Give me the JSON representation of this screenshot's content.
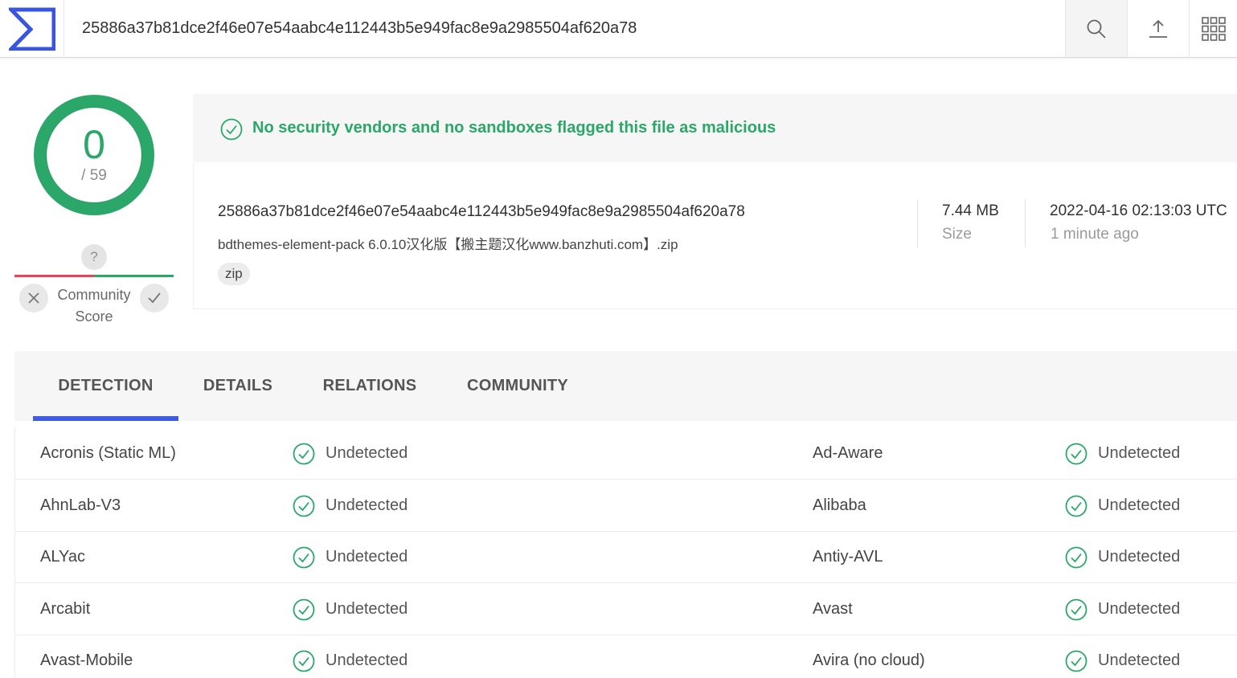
{
  "colors": {
    "clean": "#2aa769",
    "malicious": "#e5445a",
    "accent": "#3f5be0",
    "logo": "#3954e0"
  },
  "header": {
    "search_value": "25886a37b81dce2f46e07e54aabc4e112443b5e949fac8e9a2985504af620a78",
    "icons": [
      "logo-sigma-icon",
      "search-icon",
      "upload-icon",
      "apps-grid-icon"
    ]
  },
  "score": {
    "detections": "0",
    "total": "/ 59",
    "community_question": "?",
    "community_label_line1": "Community",
    "community_label_line2": "Score"
  },
  "banner": {
    "text": "No security vendors and no sandboxes flagged this file as malicious"
  },
  "file": {
    "hash": "25886a37b81dce2f46e07e54aabc4e112443b5e949fac8e9a2985504af620a78",
    "name": "bdthemes-element-pack 6.0.10汉化版【搬主题汉化www.banzhuti.com】.zip",
    "tag": "zip",
    "size_value": "7.44 MB",
    "size_label": "Size",
    "date_value": "2022-04-16 02:13:03 UTC",
    "date_label": "1 minute ago"
  },
  "tabs": [
    "DETECTION",
    "DETAILS",
    "RELATIONS",
    "COMMUNITY"
  ],
  "detections": [
    {
      "left_vendor": "Acronis (Static ML)",
      "left_result": "Undetected",
      "right_vendor": "Ad-Aware",
      "right_result": "Undetected"
    },
    {
      "left_vendor": "AhnLab-V3",
      "left_result": "Undetected",
      "right_vendor": "Alibaba",
      "right_result": "Undetected"
    },
    {
      "left_vendor": "ALYac",
      "left_result": "Undetected",
      "right_vendor": "Antiy-AVL",
      "right_result": "Undetected"
    },
    {
      "left_vendor": "Arcabit",
      "left_result": "Undetected",
      "right_vendor": "Avast",
      "right_result": "Undetected"
    },
    {
      "left_vendor": "Avast-Mobile",
      "left_result": "Undetected",
      "right_vendor": "Avira (no cloud)",
      "right_result": "Undetected"
    }
  ]
}
